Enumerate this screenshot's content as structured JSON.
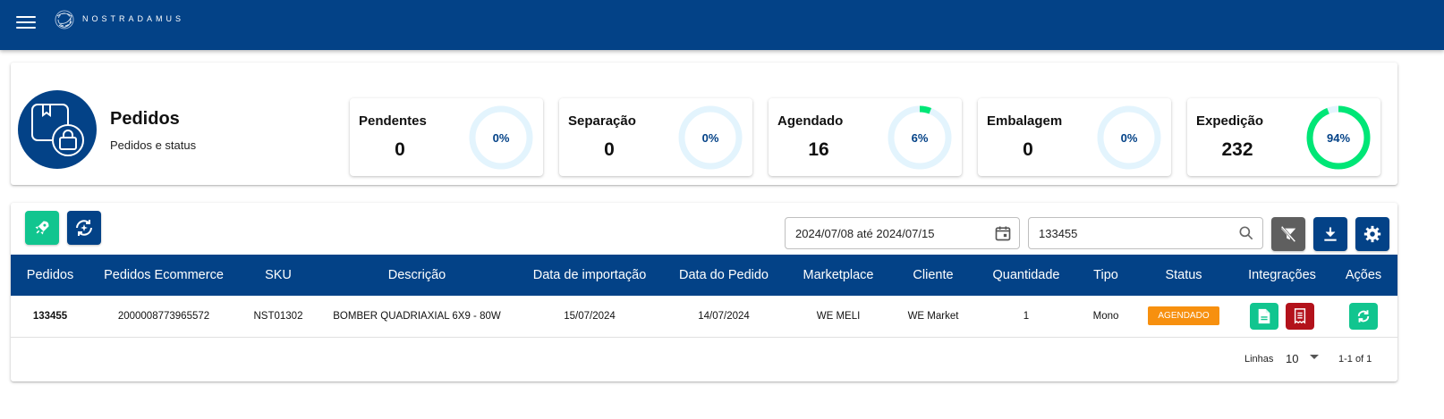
{
  "app": {
    "logo_text": "NOSTRADAMUS"
  },
  "summary": {
    "title": "Pedidos",
    "subtitle": "Pedidos e status",
    "stats": [
      {
        "label": "Pendentes",
        "value": "0",
        "pct": "0%",
        "fraction": 0,
        "color": "#00e676"
      },
      {
        "label": "Separação",
        "value": "0",
        "pct": "0%",
        "fraction": 0,
        "color": "#00e676"
      },
      {
        "label": "Agendado",
        "value": "16",
        "pct": "6%",
        "fraction": 0.06,
        "color": "#00e676"
      },
      {
        "label": "Embalagem",
        "value": "0",
        "pct": "0%",
        "fraction": 0,
        "color": "#00e676"
      },
      {
        "label": "Expedição",
        "value": "232",
        "pct": "94%",
        "fraction": 0.94,
        "color": "#00e676"
      }
    ]
  },
  "toolbar": {
    "date_range": "2024/07/08 até 2024/07/15",
    "search_value": "133455"
  },
  "table": {
    "headers": [
      "Pedidos",
      "Pedidos Ecommerce",
      "SKU",
      "Descrição",
      "Data de importação",
      "Data do Pedido",
      "Marketplace",
      "Cliente",
      "Quantidade",
      "Tipo",
      "Status",
      "Integrações",
      "Ações"
    ],
    "rows": [
      {
        "pedido": "133455",
        "ecommerce": "2000008773965572",
        "sku": "NST01302",
        "descricao": "BOMBER QUADRIAXIAL 6X9 - 80W",
        "data_importacao": "15/07/2024",
        "data_pedido": "14/07/2024",
        "marketplace": "WE MELI",
        "cliente": "WE Market",
        "quantidade": "1",
        "tipo": "Mono",
        "status": "AGENDADO"
      }
    ]
  },
  "pagination": {
    "rows_label": "Linhas",
    "rows_value": "10",
    "range": "1-1 of 1"
  },
  "colors": {
    "brand": "#034287",
    "accent_green": "#11c58f",
    "status_orange": "#f7900f",
    "danger_red": "#b3121b",
    "ring_track": "#e3f4fd"
  }
}
